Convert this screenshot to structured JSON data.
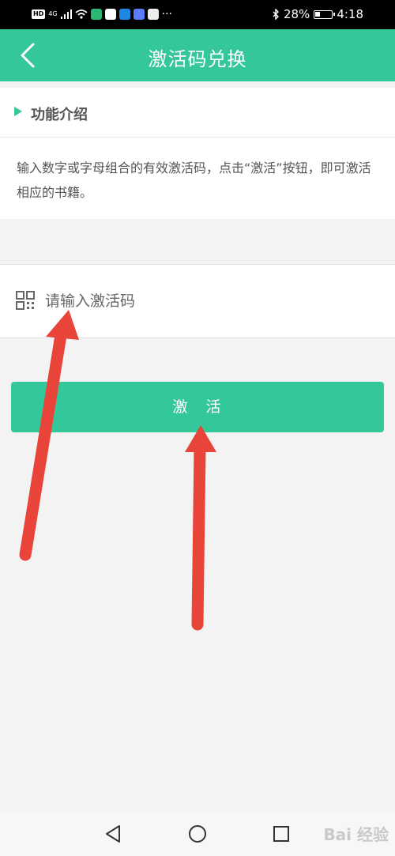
{
  "status_bar": {
    "hd": "HD",
    "signal_label": "4G",
    "battery": "28%",
    "time": "4:18",
    "dots": "···"
  },
  "header": {
    "title": "激活码兑换"
  },
  "intro": {
    "heading": "功能介绍",
    "text": "输入数字或字母组合的有效激活码，点击“激活”按钮，即可激活相应的书籍。"
  },
  "code_input": {
    "placeholder": "请输入激活码",
    "value": ""
  },
  "activate_button": {
    "label": "激　活"
  },
  "watermark": {
    "text": "Bai 经验"
  },
  "colors": {
    "accent": "#34c79a",
    "annotation_arrow": "#e8443a"
  }
}
